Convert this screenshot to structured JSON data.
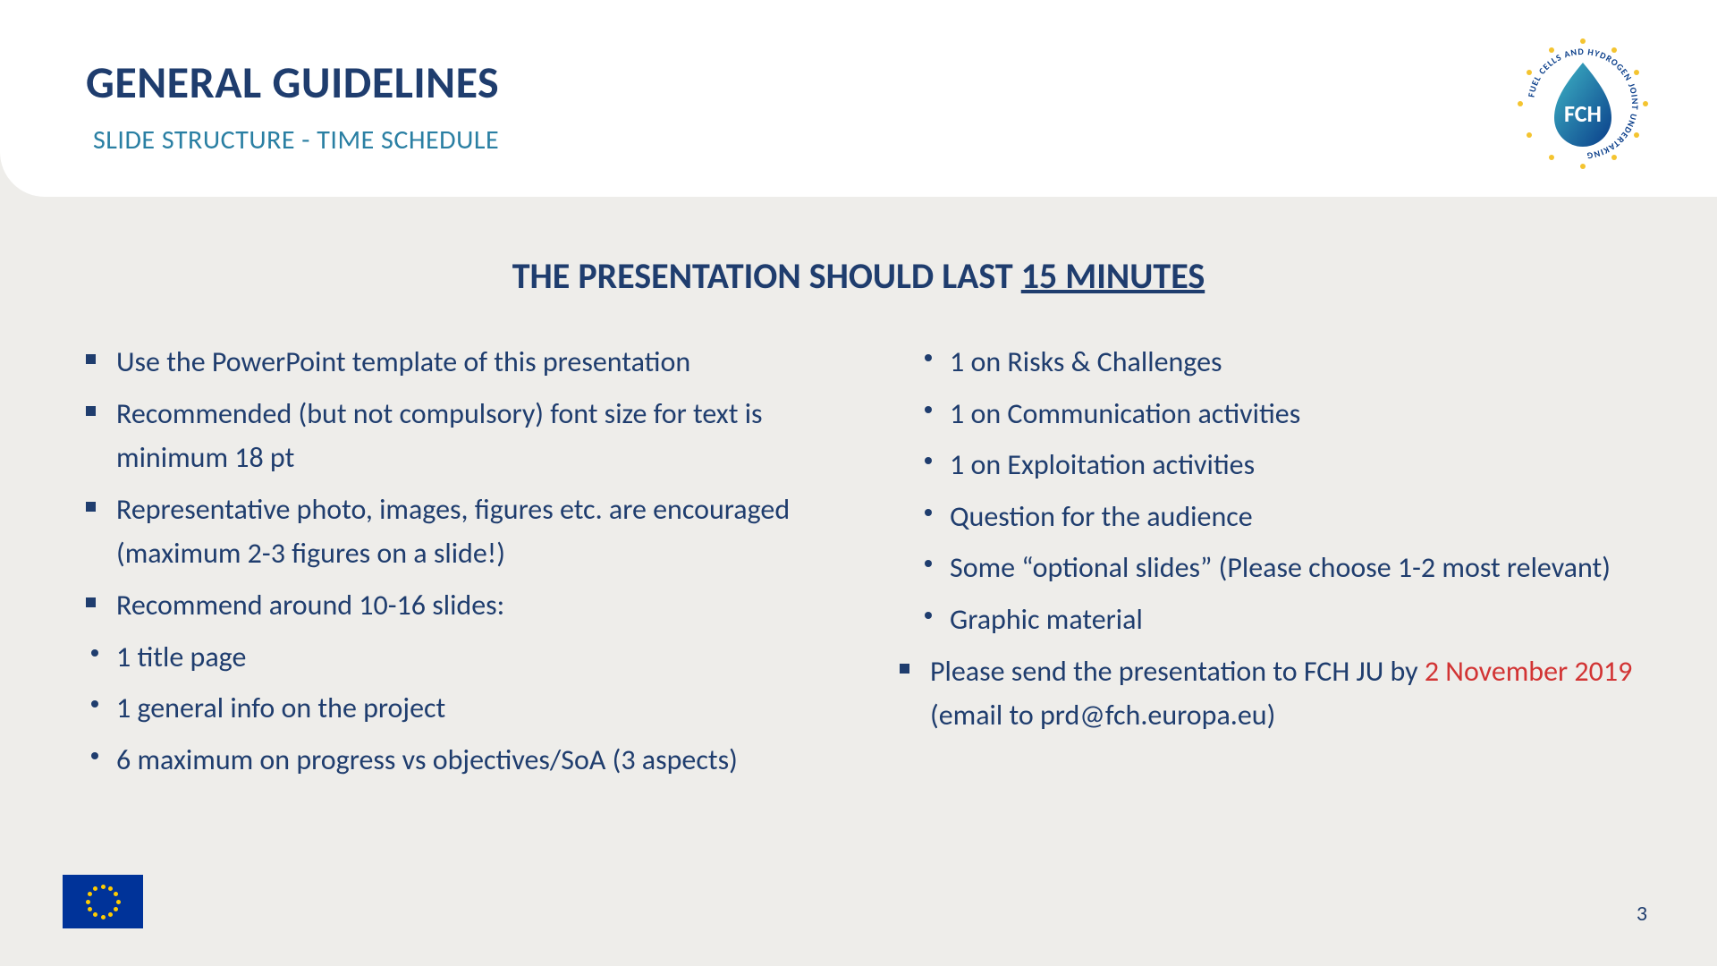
{
  "header": {
    "title": "GENERAL GUIDELINES",
    "subtitle": "SLIDE STRUCTURE - TIME SCHEDULE"
  },
  "logo": {
    "acronym": "FCH",
    "ring_text": "FUEL CELLS AND HYDROGEN JOINT UNDERTAKING"
  },
  "duration": {
    "prefix": "THE PRESENTATION SHOULD LAST ",
    "emphasis": "15 MINUTES"
  },
  "left_column": [
    {
      "style": "square",
      "text": "Use the PowerPoint template of this presentation"
    },
    {
      "style": "square",
      "text": "Recommended (but not compulsory) font size for text is minimum 18 pt"
    },
    {
      "style": "square",
      "text": "Representative photo, images, figures etc. are encouraged (maximum 2-3 figures on a slide!)"
    },
    {
      "style": "square",
      "text": "Recommend around 10-16 slides:"
    },
    {
      "style": "disc",
      "text": "1 title page"
    },
    {
      "style": "disc",
      "text": "1 general info on the project"
    },
    {
      "style": "disc",
      "text": "6 maximum on progress vs objectives/SoA (3 aspects)"
    }
  ],
  "right_column": [
    {
      "style": "disc",
      "text": "1 on Risks & Challenges"
    },
    {
      "style": "disc",
      "text": "1 on Communication activities"
    },
    {
      "style": "disc",
      "text": "1 on Exploitation activities"
    },
    {
      "style": "disc",
      "text": "Question for the audience"
    },
    {
      "style": "disc",
      "text": "Some “optional slides” (Please choose 1-2 most relevant)"
    },
    {
      "style": "disc",
      "text": "Graphic material"
    }
  ],
  "deadline": {
    "prefix": "Please send the presentation to FCH JU by ",
    "date": "2 November 2019",
    "email_line": "(email to prd@fch.europa.eu)"
  },
  "page_number": "3"
}
